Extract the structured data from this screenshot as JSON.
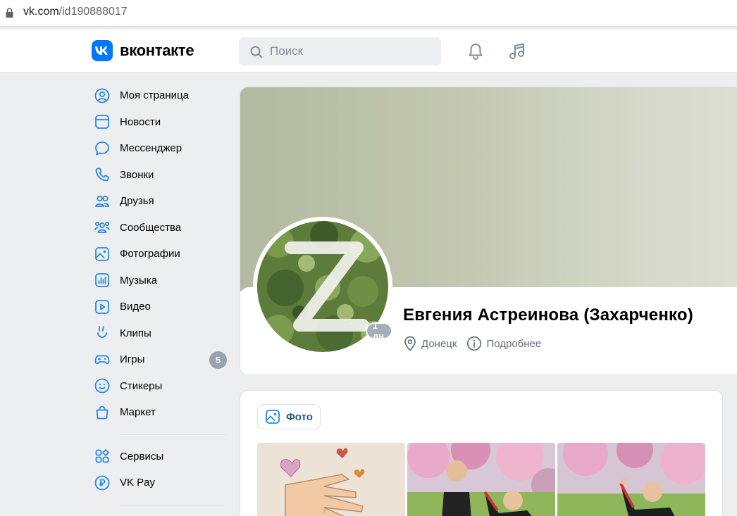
{
  "browser": {
    "url_host": "vk.com",
    "url_path": "/id190888017"
  },
  "header": {
    "logo_text": "вконтакте",
    "search_placeholder": "Поиск"
  },
  "sidebar": {
    "items": [
      {
        "label": "Моя страница",
        "icon": "user-circle-icon"
      },
      {
        "label": "Новости",
        "icon": "newsfeed-icon"
      },
      {
        "label": "Мессенджер",
        "icon": "message-icon"
      },
      {
        "label": "Звонки",
        "icon": "phone-icon"
      },
      {
        "label": "Друзья",
        "icon": "friends-icon"
      },
      {
        "label": "Сообщества",
        "icon": "communities-icon"
      },
      {
        "label": "Фотографии",
        "icon": "photo-icon"
      },
      {
        "label": "Музыка",
        "icon": "music-icon"
      },
      {
        "label": "Видео",
        "icon": "video-icon"
      },
      {
        "label": "Клипы",
        "icon": "clips-icon"
      },
      {
        "label": "Игры",
        "icon": "gamepad-icon",
        "badge": "5"
      },
      {
        "label": "Стикеры",
        "icon": "smile-icon"
      },
      {
        "label": "Маркет",
        "icon": "bag-icon"
      }
    ],
    "extra": [
      {
        "label": "Сервисы",
        "icon": "services-icon"
      },
      {
        "label": "VK Pay",
        "icon": "ruble-icon"
      }
    ]
  },
  "profile": {
    "name": "Евгения Астреинова (Захарченко)",
    "online": "1 дн",
    "city": "Донецк",
    "more": "Подробнее"
  },
  "photos": {
    "button": "Фото"
  },
  "colors": {
    "accent": "#0077ff",
    "link": "#2a5885",
    "bg": "#edeef0",
    "icon": "#2688eb"
  }
}
